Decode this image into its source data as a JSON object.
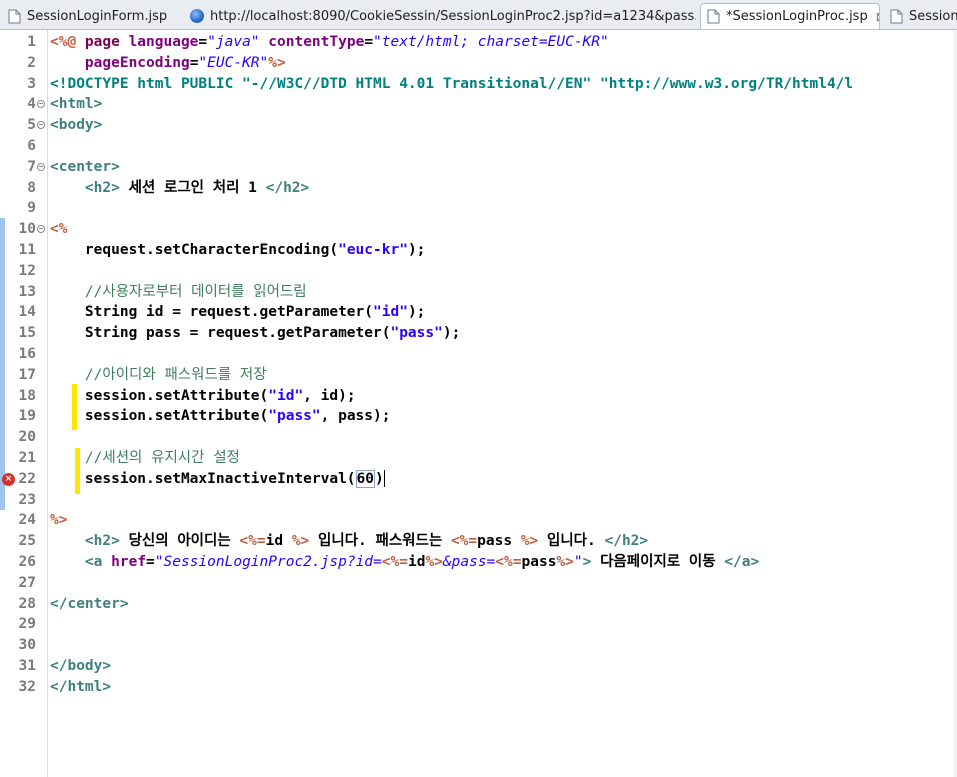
{
  "tabs": [
    {
      "label": "SessionLoginForm.jsp",
      "icon": "jsp-file-icon",
      "active": false
    },
    {
      "label": "http://localhost:8090/CookieSessin/SessionLoginProc2.jsp?id=a1234&pass...",
      "icon": "globe-icon",
      "active": false
    },
    {
      "label": "*SessionLoginProc.jsp",
      "icon": "jsp-file-icon",
      "active": true,
      "close": "⊠"
    },
    {
      "label": "SessionL",
      "icon": "jsp-file-icon",
      "active": false
    }
  ],
  "lines": [
    {
      "n": "1",
      "segs": [
        [
          "jsp",
          "<%@ "
        ],
        [
          "kw",
          "page "
        ],
        [
          "attr",
          "language"
        ],
        [
          "txt",
          "="
        ],
        [
          "str",
          "\"java\""
        ],
        [
          "txt",
          " "
        ],
        [
          "attr",
          "contentType"
        ],
        [
          "txt",
          "="
        ],
        [
          "str",
          "\"text/html; charset=EUC-KR\""
        ]
      ]
    },
    {
      "n": "2",
      "segs": [
        [
          "txt",
          "    "
        ],
        [
          "attr",
          "pageEncoding"
        ],
        [
          "txt",
          "="
        ],
        [
          "str",
          "\"EUC-KR\""
        ],
        [
          "jsp",
          "%>"
        ]
      ]
    },
    {
      "n": "3",
      "segs": [
        [
          "doct",
          "<!DOCTYPE html PUBLIC \"-//W3C//DTD HTML 4.01 Transitional//EN\" \"http://www.w3.org/TR/html4/l"
        ]
      ]
    },
    {
      "n": "4",
      "fold": true,
      "segs": [
        [
          "tag",
          "<html>"
        ]
      ]
    },
    {
      "n": "5",
      "fold": true,
      "segs": [
        [
          "tag",
          "<body>"
        ]
      ]
    },
    {
      "n": "6",
      "segs": []
    },
    {
      "n": "7",
      "fold": true,
      "segs": [
        [
          "tag",
          "<center>"
        ]
      ]
    },
    {
      "n": "8",
      "segs": [
        [
          "txt",
          "    "
        ],
        [
          "tag",
          "<h2>"
        ],
        [
          "txt",
          " 세션 로그인 처리 1 "
        ],
        [
          "tag",
          "</h2>"
        ]
      ]
    },
    {
      "n": "9",
      "segs": []
    },
    {
      "n": "10",
      "fold": true,
      "segs": [
        [
          "jsp",
          "<%"
        ]
      ]
    },
    {
      "n": "11",
      "segs": [
        [
          "txt",
          "    request.setCharacterEncoding("
        ],
        [
          "sstr",
          "\"euc-kr\""
        ],
        [
          "txt",
          ");"
        ]
      ]
    },
    {
      "n": "12",
      "segs": []
    },
    {
      "n": "13",
      "segs": [
        [
          "txt",
          "    "
        ],
        [
          "cmt",
          "//사용자로부터 데이터를 읽어드림"
        ]
      ]
    },
    {
      "n": "14",
      "segs": [
        [
          "txt",
          "    String id = request.getParameter("
        ],
        [
          "sstr",
          "\"id\""
        ],
        [
          "txt",
          ");"
        ]
      ]
    },
    {
      "n": "15",
      "segs": [
        [
          "txt",
          "    String pass = request.getParameter("
        ],
        [
          "sstr",
          "\"pass\""
        ],
        [
          "txt",
          ");"
        ]
      ]
    },
    {
      "n": "16",
      "segs": []
    },
    {
      "n": "17",
      "segs": [
        [
          "txt",
          "    "
        ],
        [
          "cmt",
          "//아이디와 패스워드를 저장"
        ]
      ]
    },
    {
      "n": "18",
      "segs": [
        [
          "txt",
          "    session.setAttribute("
        ],
        [
          "sstr",
          "\"id\""
        ],
        [
          "txt",
          ", id);"
        ]
      ]
    },
    {
      "n": "19",
      "segs": [
        [
          "txt",
          "    session.setAttribute("
        ],
        [
          "sstr",
          "\"pass\""
        ],
        [
          "txt",
          ", pass);"
        ]
      ]
    },
    {
      "n": "20",
      "segs": []
    },
    {
      "n": "21",
      "segs": [
        [
          "txt",
          "    "
        ],
        [
          "cmt",
          "//세션의 유지시간 설정"
        ]
      ]
    },
    {
      "n": "22",
      "error": true,
      "segs": [
        [
          "txt",
          "    session.setMaxInactiveInterval("
        ],
        [
          "box",
          "60"
        ],
        [
          "txt",
          ")"
        ],
        [
          "caret",
          ""
        ]
      ]
    },
    {
      "n": "23",
      "segs": []
    },
    {
      "n": "24",
      "segs": [
        [
          "jsp",
          "%>"
        ]
      ]
    },
    {
      "n": "25",
      "segs": [
        [
          "txt",
          "    "
        ],
        [
          "tag",
          "<h2>"
        ],
        [
          "txt",
          " 당신의 아이디는 "
        ],
        [
          "jsp",
          "<%="
        ],
        [
          "txt",
          "id "
        ],
        [
          "jsp",
          "%>"
        ],
        [
          "txt",
          " 입니다. 패스워드는 "
        ],
        [
          "jsp",
          "<%="
        ],
        [
          "txt",
          "pass "
        ],
        [
          "jsp",
          "%>"
        ],
        [
          "txt",
          " 입니다. "
        ],
        [
          "tag",
          "</h2>"
        ]
      ]
    },
    {
      "n": "26",
      "segs": [
        [
          "txt",
          "    "
        ],
        [
          "tag",
          "<a "
        ],
        [
          "attr",
          "href"
        ],
        [
          "txt",
          "="
        ],
        [
          "str",
          "\"SessionLoginProc2.jsp?id="
        ],
        [
          "jsp",
          "<%="
        ],
        [
          "txt",
          "id"
        ],
        [
          "jsp",
          "%>"
        ],
        [
          "str",
          "&pass="
        ],
        [
          "jsp",
          "<%="
        ],
        [
          "txt",
          "pass"
        ],
        [
          "jsp",
          "%>"
        ],
        [
          "str",
          "\""
        ],
        [
          "tag",
          ">"
        ],
        [
          "txt",
          " 다음페이지로 이동 "
        ],
        [
          "tag",
          "</a>"
        ]
      ]
    },
    {
      "n": "27",
      "segs": []
    },
    {
      "n": "28",
      "segs": [
        [
          "tag",
          "</center>"
        ]
      ]
    },
    {
      "n": "29",
      "segs": []
    },
    {
      "n": "30",
      "segs": []
    },
    {
      "n": "31",
      "segs": [
        [
          "tag",
          "</body>"
        ]
      ]
    },
    {
      "n": "32",
      "segs": [
        [
          "tag",
          "</html>"
        ]
      ]
    }
  ],
  "colors": {
    "keyword": "#7f0055",
    "tag": "#3f7f7f",
    "attribute": "#7f007f",
    "string": "#2a00ff",
    "jsp_delimiter": "#bf5f3f",
    "comment": "#3f7f5f",
    "highlight": "#ffe600",
    "error": "#d9302c",
    "change_bar": "#9ec3ee"
  }
}
